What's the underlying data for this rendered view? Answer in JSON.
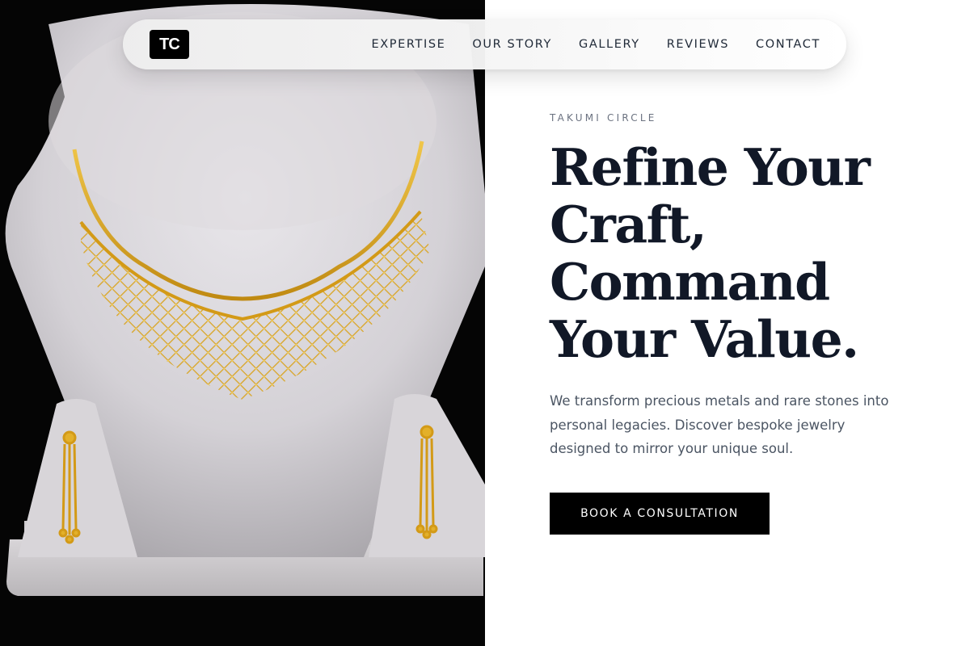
{
  "nav": {
    "logo_text": "TC",
    "links": [
      "EXPERTISE",
      "OUR STORY",
      "GALLERY",
      "REVIEWS",
      "CONTACT"
    ]
  },
  "hero": {
    "eyebrow": "TAKUMI CIRCLE",
    "headline_lines": [
      "Refine Your",
      "Craft,",
      "Command",
      "Your Value."
    ],
    "description": "We transform precious metals and rare stones into personal legacies. Discover bespoke jewelry designed to mirror your unique soul.",
    "cta_label": "BOOK A CONSULTATION"
  },
  "colors": {
    "accent": "#000000",
    "headline": "#111827",
    "body_text": "#4b5563",
    "gold": "#d4a017"
  }
}
